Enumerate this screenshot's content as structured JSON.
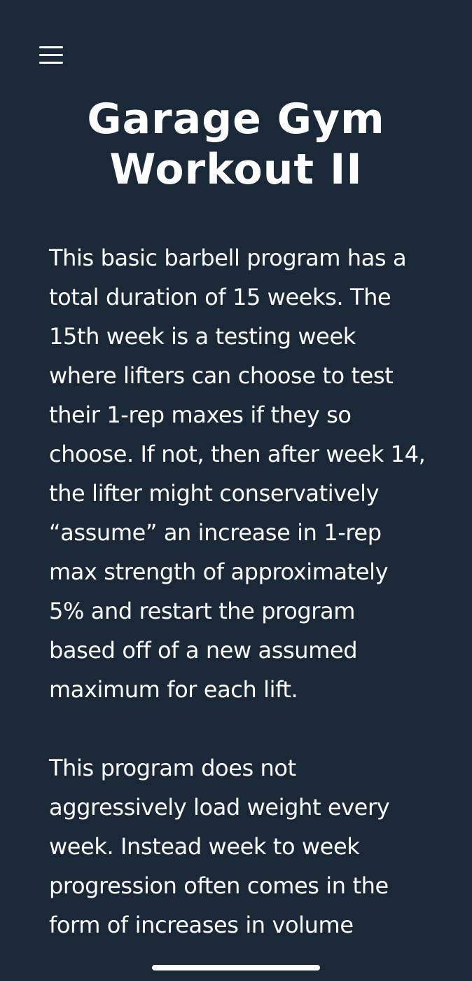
{
  "header": {
    "menu_icon": "hamburger-menu-icon",
    "title": "Garage Gym Workout II"
  },
  "article": {
    "paragraphs": [
      "This basic barbell program has a total duration of 15 weeks. The 15th week is a testing week where lifters can choose to test their 1-rep maxes if they so choose. If not, then after week 14, the lifter might conservatively “assume” an increase in 1-rep max strength of approximately 5% and restart the program based off of a new assumed maximum for each lift.",
      "This program does not aggressively load weight every week. Instead week to week progression often comes in the form of increases in volume"
    ]
  },
  "colors": {
    "background": "#1b2838",
    "text": "#ffffff"
  }
}
